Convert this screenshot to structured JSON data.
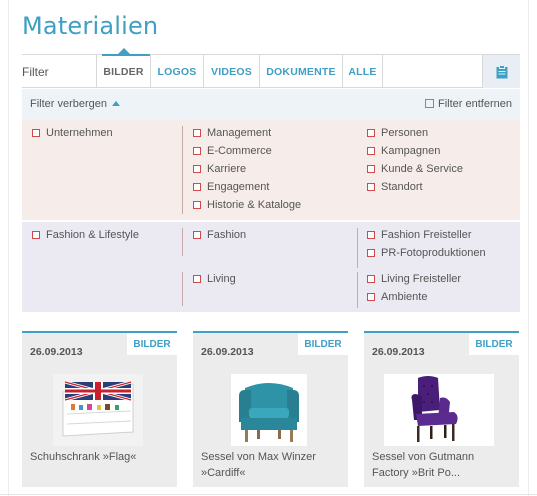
{
  "page": {
    "title": "Materialien"
  },
  "tabs": {
    "filter_label": "Filter",
    "items": [
      {
        "label": "BILDER",
        "active": true
      },
      {
        "label": "LOGOS",
        "active": false
      },
      {
        "label": "VIDEOS",
        "active": false
      },
      {
        "label": "DOKUMENTE",
        "active": false
      },
      {
        "label": "ALLE",
        "active": false
      }
    ],
    "clipboard_icon": "clipboard-icon"
  },
  "filterbar": {
    "hide_label": "Filter verbergen",
    "remove_label": "Filter entfernen"
  },
  "filters": {
    "group1": {
      "col1": [
        "Unternehmen"
      ],
      "col2": [
        "Management",
        "E-Commerce",
        "Karriere",
        "Engagement",
        "Historie & Kataloge"
      ],
      "col3": [
        "Personen",
        "Kampagnen",
        "Kunde & Service",
        "Standort"
      ]
    },
    "group2": {
      "col1": [
        "Fashion & Lifestyle"
      ],
      "col2a": [
        "Fashion"
      ],
      "col3a": [
        "Fashion Freisteller",
        "PR-Fotoproduktionen"
      ],
      "col2b": [
        "Living"
      ],
      "col3b": [
        "Living Freisteller",
        "Ambiente"
      ]
    }
  },
  "cards": [
    {
      "date": "26.09.2013",
      "badge": "BILDER",
      "title": "Schuhschrank »Flag«",
      "image": "flag-shoe-cabinet"
    },
    {
      "date": "26.09.2013",
      "badge": "BILDER",
      "title": "Sessel von Max Winzer »Cardiff«",
      "image": "teal-armchair"
    },
    {
      "date": "26.09.2013",
      "badge": "BILDER",
      "title": "Sessel von Gutmann Factory »Brit Po...",
      "image": "purple-armchair"
    }
  ],
  "colors": {
    "accent": "#3f9fc4",
    "checkbox_red": "#cf4a4a",
    "panel1_bg": "#f6ecea",
    "panel2_bg": "#ebe9f2"
  }
}
